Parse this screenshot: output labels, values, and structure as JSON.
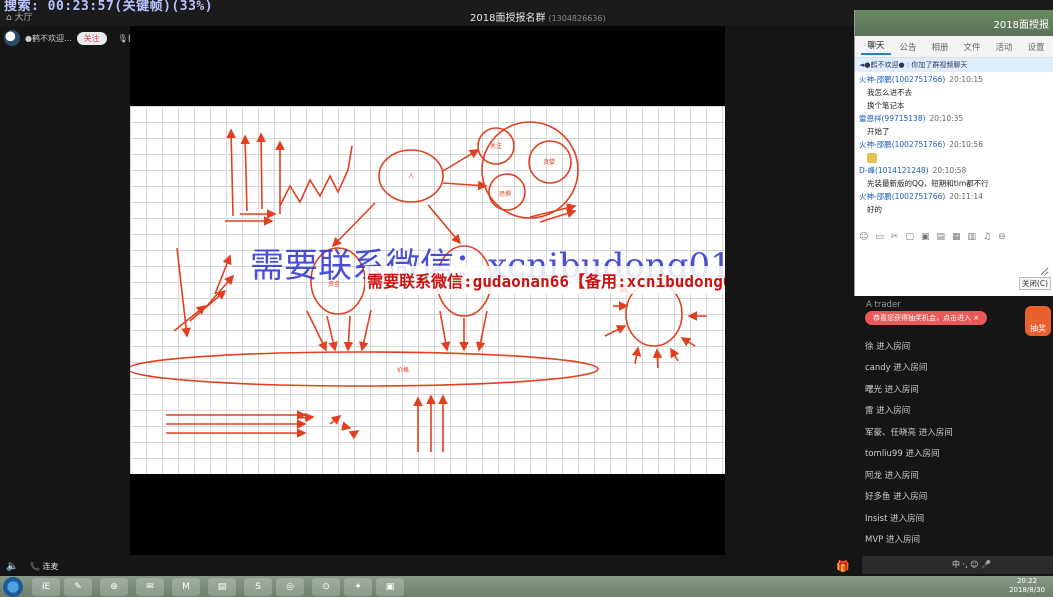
{
  "header": {
    "timer": "搜索: 00:23:57(关键帧)(33%)",
    "hall_label": "大厅",
    "room_title": "2018面授报名群",
    "room_id": "(1304826636)"
  },
  "host": {
    "name": "●鹤不欢迎...",
    "follow_label": "关注",
    "mic_label": "排麦"
  },
  "board": {
    "labels": [
      "人",
      "资金",
      "价格",
      "技术",
      "关注",
      "贪婪",
      "恐惧",
      "关闭",
      "持股",
      "出局"
    ],
    "watermark_blue": "需要联系微信：xcnibudong0105",
    "watermark_red": "需要联系微信:gudaonan66【备用:xcnibudong0105】"
  },
  "controls": {
    "volume_icon": "speaker-icon",
    "call_label": "连麦"
  },
  "chat": {
    "title": "2018面授报",
    "tabs": [
      "聊天",
      "公告",
      "相册",
      "文件",
      "活动",
      "设置"
    ],
    "notice": "◄●鹤不欢迎● : 你加了群视频聊天",
    "messages": [
      {
        "sender": "火神-邵鹏(1002751766)",
        "time": "20:10:15"
      },
      {
        "body": "我怎么进不去"
      },
      {
        "body": "换个笔记本"
      },
      {
        "sender": "雷恩祥(99715138)",
        "time": "20:10:35"
      },
      {
        "body": "开始了"
      },
      {
        "sender": "火神-邵鹏(1002751766)",
        "time": "20:10:56"
      },
      {
        "emoji": true
      },
      {
        "sender": "D-峰(1014121248)",
        "time": "20:10:58"
      },
      {
        "body": "先装最新版的QQ，短期和tim都不行"
      },
      {
        "sender": "火神-邵鹏(1002751766)",
        "time": "20:11:14"
      },
      {
        "body": "好的"
      }
    ],
    "close_label": "关闭(C)"
  },
  "feed": {
    "trader_label": "A trader",
    "banner": "恭喜您获得抽奖机会，点击进入 ×",
    "lottery_label": "抽奖",
    "entries": [
      "徐 进入房间",
      "candy 进入房间",
      "曙光 进入房间",
      "雷 进入房间",
      "军豪、任晓亮 进入房间",
      "tomliu99 进入房间",
      "阿龙 进入房间",
      "好多鱼 进入房间",
      "Insist 进入房间",
      "MVP 进入房间"
    ],
    "ime_label": "中 ·, ☺ 🎤"
  },
  "taskbar": {
    "apps": [
      "IE",
      "✎",
      "⊕",
      "✉",
      "M",
      "▤",
      "S",
      "◎",
      "⊙",
      "✦",
      "▣"
    ],
    "clock_time": "20:22",
    "clock_date": "2018/8/30"
  }
}
